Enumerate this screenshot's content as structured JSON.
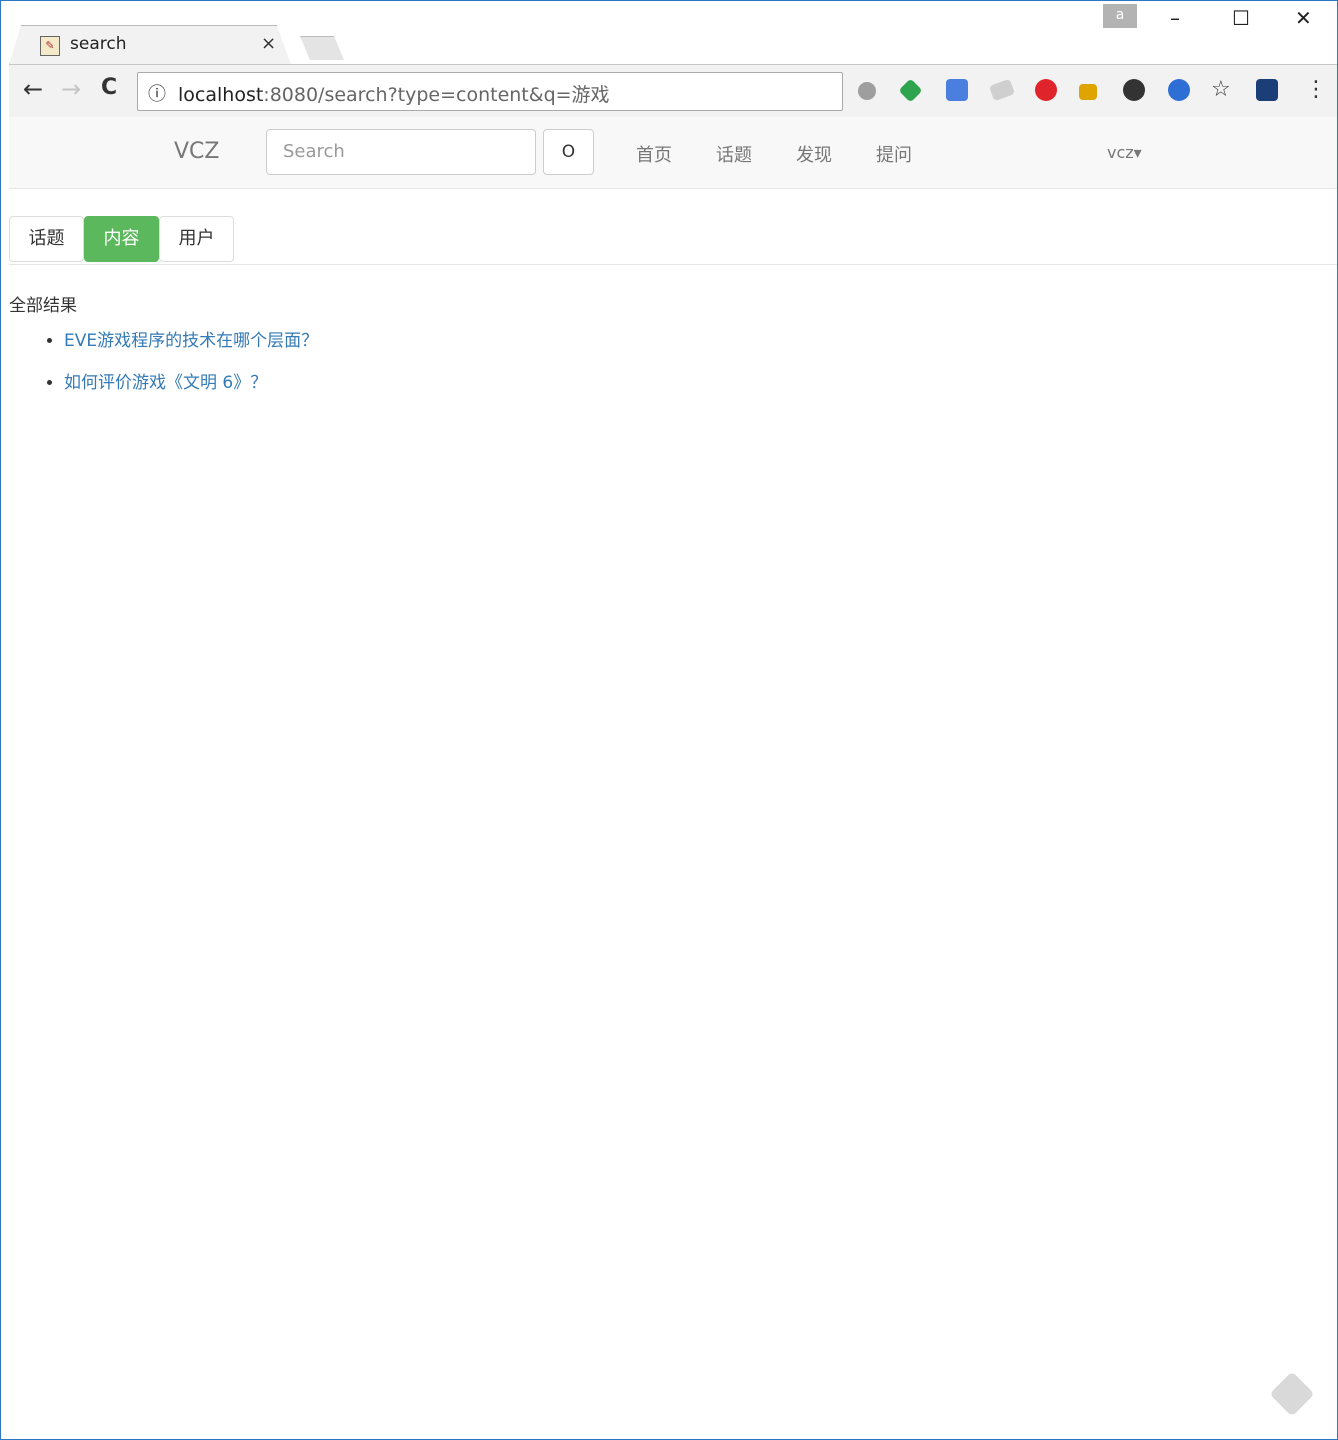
{
  "browser": {
    "tab_title": "search",
    "tab_close": "×",
    "favicon_glyph": "✎",
    "profile_label": "a",
    "window_controls": {
      "minimize": "–",
      "maximize": "☐",
      "close": "✕"
    },
    "nav": {
      "back": "←",
      "forward": "→",
      "reload": "C"
    },
    "address_host": "localhost",
    "address_rest": ":8080/search?type=content&q=游戏",
    "info_icon": "ⓘ",
    "star_icon": "☆",
    "menu_icon": "⋮",
    "extensions": [
      {
        "name": "record-icon",
        "color": "#9e9e9e"
      },
      {
        "name": "green-diamond-icon",
        "color": "#2ea44f"
      },
      {
        "name": "translate-icon",
        "color": "#4a7fe0"
      },
      {
        "name": "tag-icon",
        "color": "#bdbdbd"
      },
      {
        "name": "adblock-icon",
        "color": "#e0242b"
      },
      {
        "name": "chart-icon",
        "color": "#e0a400"
      },
      {
        "name": "circle-e-icon",
        "color": "#333333"
      },
      {
        "name": "globe-icon",
        "color": "#2d6fd4"
      },
      {
        "name": "shield-icon",
        "color": "#1c3e77"
      }
    ]
  },
  "app": {
    "brand": "VCZ",
    "search_placeholder": "Search",
    "search_button": "O",
    "nav_links": [
      "首页",
      "话题",
      "发现",
      "提问"
    ],
    "user": "vcz",
    "caret": "▾"
  },
  "tabs": [
    {
      "label": "话题",
      "active": false
    },
    {
      "label": "内容",
      "active": true
    },
    {
      "label": "用户",
      "active": false
    }
  ],
  "results": {
    "title": "全部结果",
    "items": [
      "EVE游戏程序的技术在哪个层面？",
      "如何评价游戏《文明 6》？"
    ]
  },
  "colors": {
    "active_pill": "#5cb85c",
    "link": "#337ab7",
    "window_border": "#2b78c5"
  }
}
